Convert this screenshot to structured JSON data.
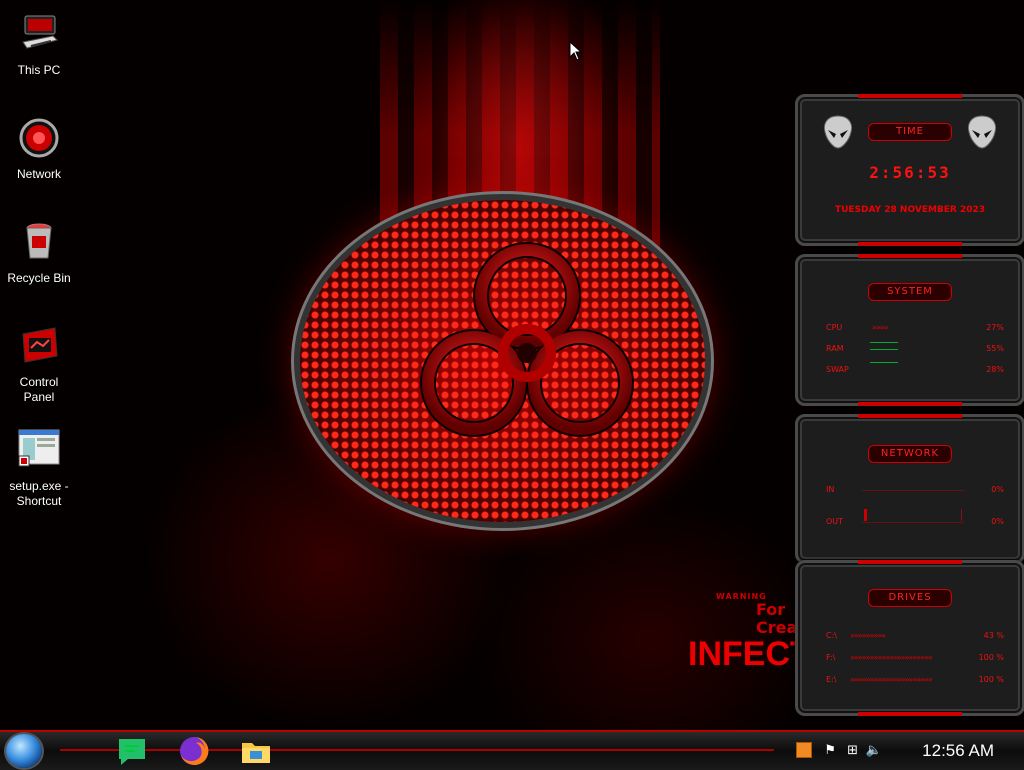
{
  "desktop_icons": [
    {
      "label": "This PC",
      "icon": "computer-icon"
    },
    {
      "label": "Network",
      "icon": "network-icon"
    },
    {
      "label": "Recycle Bin",
      "icon": "recycle-bin-icon"
    },
    {
      "label": "Control Panel",
      "icon": "control-panel-icon"
    },
    {
      "label": "setup.exe - Shortcut",
      "icon": "shortcut-icon"
    }
  ],
  "wallpaper": {
    "warning": "WARNING",
    "for_text": "For",
    "crea_text": "Crea",
    "infect_text": "INFECT"
  },
  "gadgets": {
    "time": {
      "title": "TIME",
      "clock": "2:56:53",
      "date": "TUESDAY 28 NOVEMBER 2023"
    },
    "system": {
      "title": "SYSTEM",
      "rows": [
        {
          "label": "CPU",
          "value": "27%",
          "level": 0.27
        },
        {
          "label": "RAM",
          "value": "55%",
          "level": 0.55
        },
        {
          "label": "SWAP",
          "value": "28%",
          "level": 0.28
        }
      ]
    },
    "network": {
      "title": "NETWORK",
      "rows": [
        {
          "label": "IN",
          "value": "0%"
        },
        {
          "label": "OUT",
          "value": "0%"
        }
      ]
    },
    "drives": {
      "title": "DRIVES",
      "rows": [
        {
          "label": "C:\\",
          "value": "43 %",
          "level": 0.43
        },
        {
          "label": "F:\\",
          "value": "100 %",
          "level": 1.0
        },
        {
          "label": "E:\\",
          "value": "100 %",
          "level": 1.0
        }
      ]
    }
  },
  "taskbar": {
    "start_icon": "start-orb-icon",
    "apps": [
      "chat-app-icon",
      "firefox-icon",
      "file-explorer-icon"
    ],
    "tray_icons": [
      "app-tray-icon",
      "flag-icon",
      "network-tray-icon",
      "volume-icon"
    ],
    "time": "12:56 AM"
  },
  "colors": {
    "accent": "#dd0000",
    "background": "#000000",
    "gadget_bg": "#1d1d1d"
  }
}
